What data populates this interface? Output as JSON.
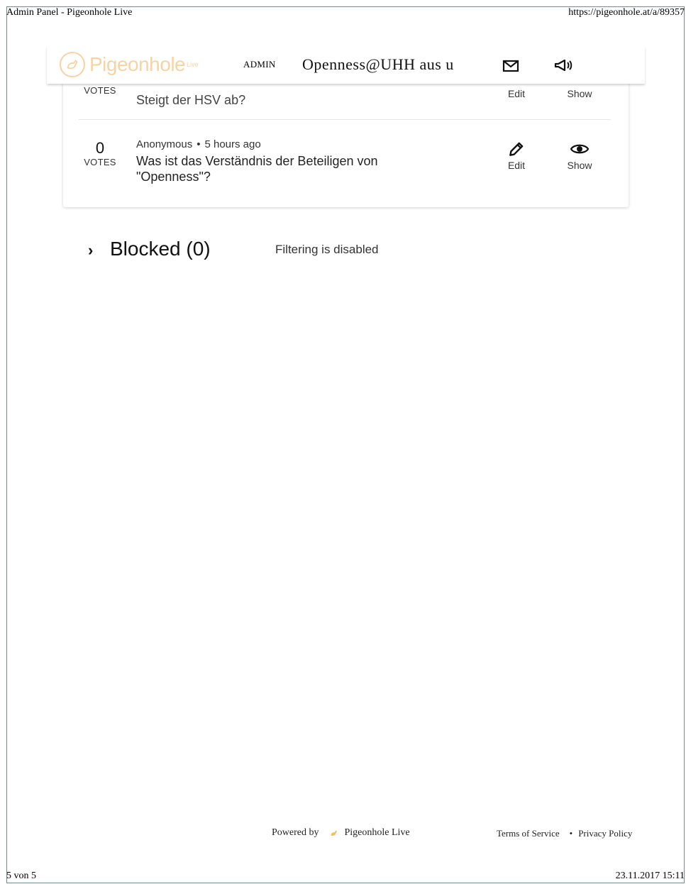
{
  "print_header": {
    "title": "Admin Panel - Pigeonhole Live",
    "url": "https://pigeonhole.at/a/89357"
  },
  "print_footer": {
    "page": "5 von 5",
    "datetime": "23.11.2017 15:11"
  },
  "topbar": {
    "logo_text": "Pigeonhole",
    "logo_sup": "Live",
    "admin_label": "ADMIN",
    "event_title": "Openness@UHH aus u",
    "icons": [
      "mail-icon",
      "megaphone-icon"
    ]
  },
  "questions": [
    {
      "votes_label": "VOTES",
      "text": "Steigt der HSV ab?",
      "edit_label": "Edit",
      "show_label": "Show"
    },
    {
      "votes": "0",
      "votes_label": "VOTES",
      "author": "Anonymous",
      "separator": "•",
      "time": "5 hours ago",
      "text": "Was ist das Verständnis der Beteiligen von \"Openness\"?",
      "edit_label": "Edit",
      "show_label": "Show"
    }
  ],
  "blocked": {
    "title": "Blocked (0)",
    "filter_status": "Filtering is disabled"
  },
  "footer": {
    "powered_by": "Powered by",
    "brand": "Pigeonhole Live",
    "terms": "Terms of Service",
    "separator": "•",
    "privacy": "Privacy Policy"
  },
  "colors": {
    "brand_orange": "#f0a94a",
    "frame_border": "#6f8f8f"
  }
}
